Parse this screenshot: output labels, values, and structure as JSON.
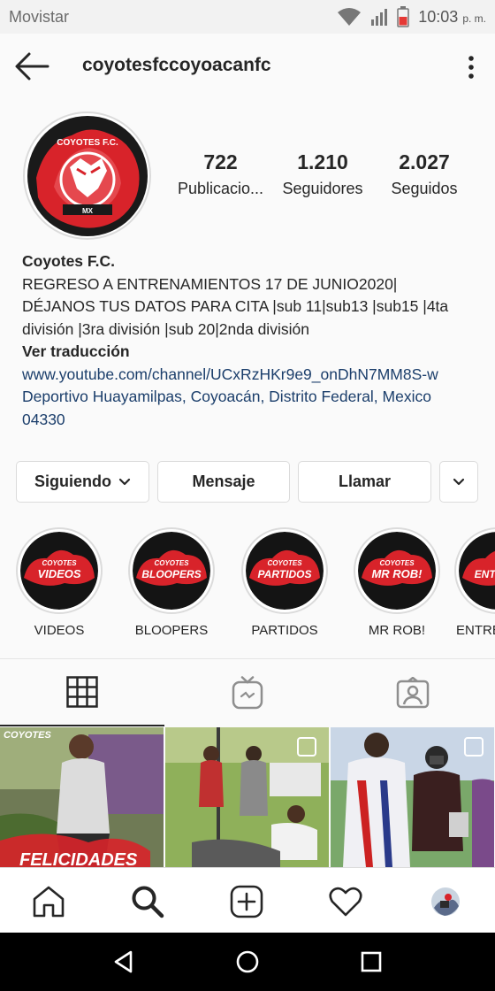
{
  "status_bar": {
    "carrier": "Movistar",
    "time": "10:03",
    "ampm": "p. m."
  },
  "header": {
    "username": "coyotesfccoyoacanfc"
  },
  "profile": {
    "avatar_text_top": "COYOTES F.C.",
    "avatar_text_bottom": "MX",
    "stats": [
      {
        "value": "722",
        "label": "Publicacio..."
      },
      {
        "value": "1.210",
        "label": "Seguidores"
      },
      {
        "value": "2.027",
        "label": "Seguidos"
      }
    ],
    "name": "Coyotes F.C.",
    "bio_line1": "REGRESO A ENTRENAMIENTOS 17 DE JUNIO2020|",
    "bio_line2": "DÉJANOS TUS DATOS PARA CITA |sub 11|sub13 |sub15 |4ta",
    "bio_line3": "división |3ra división |sub 20|2nda división",
    "translate": "Ver traducción",
    "website": "www.youtube.com/channel/UCxRzHKr9e9_onDhN7MM8S-w",
    "address_line1": "Deportivo Huayamilpas, Coyoacán, Distrito Federal, Mexico",
    "address_line2": "04330"
  },
  "actions": {
    "following": "Siguiendo",
    "message": "Mensaje",
    "call": "Llamar"
  },
  "highlights": [
    {
      "brand": "COYOTES",
      "title": "VIDEOS",
      "label": "VIDEOS"
    },
    {
      "brand": "COYOTES",
      "title": "BLOOPERS",
      "label": "BLOOPERS"
    },
    {
      "brand": "COYOTES",
      "title": "PARTIDOS",
      "label": "PARTIDOS"
    },
    {
      "brand": "COYOTES",
      "title": "MR ROB!",
      "label": "MR ROB!"
    },
    {
      "brand": "",
      "title": "ENTR",
      "label": "ENTRE"
    }
  ],
  "grid_posts": [
    {
      "overlay_top": "COYOTES",
      "overlay_bottom": "FELICIDADES"
    },
    {
      "overlay_top": "",
      "overlay_bottom": ""
    },
    {
      "overlay_top": "",
      "overlay_bottom": ""
    }
  ],
  "colors": {
    "accent_red": "#d8232a",
    "link": "#1b3e6b",
    "border": "#dbdbdb"
  }
}
